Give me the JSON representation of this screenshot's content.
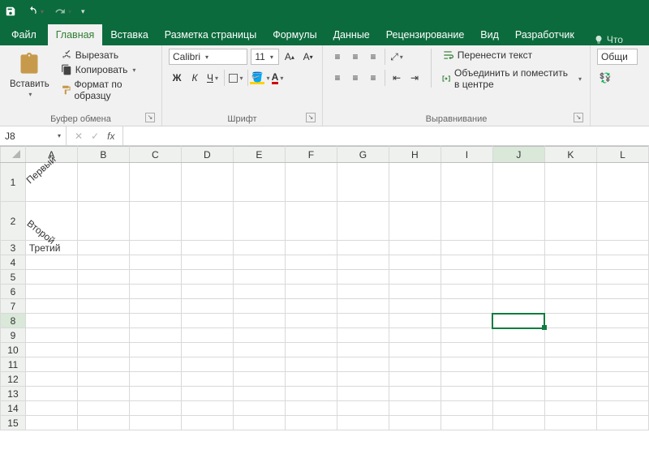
{
  "qat": {
    "save": "save",
    "undo": "undo",
    "redo": "redo"
  },
  "tabs": {
    "file": "Файл",
    "items": [
      "Главная",
      "Вставка",
      "Разметка страницы",
      "Формулы",
      "Данные",
      "Рецензирование",
      "Вид",
      "Разработчик"
    ],
    "active_index": 0,
    "tell_me": "Что"
  },
  "ribbon": {
    "clipboard": {
      "paste": "Вставить",
      "cut": "Вырезать",
      "copy": "Копировать",
      "format_painter": "Формат по образцу",
      "group_label": "Буфер обмена"
    },
    "font": {
      "name": "Calibri",
      "size": "11",
      "bold": "Ж",
      "italic": "К",
      "underline": "Ч",
      "group_label": "Шрифт"
    },
    "alignment": {
      "wrap": "Перенести текст",
      "merge": "Объединить и поместить в центре",
      "group_label": "Выравнивание"
    },
    "number": {
      "format": "Общи"
    }
  },
  "formula_bar": {
    "name_box": "J8",
    "formula": ""
  },
  "grid": {
    "columns": [
      "A",
      "B",
      "C",
      "D",
      "E",
      "F",
      "G",
      "H",
      "I",
      "J",
      "K",
      "L"
    ],
    "rows": [
      "1",
      "2",
      "3",
      "4",
      "5",
      "6",
      "7",
      "8",
      "9",
      "10",
      "11",
      "12",
      "13",
      "14",
      "15"
    ],
    "cells": {
      "A1": "Первый",
      "A2": "Второй",
      "A3": "Третий"
    },
    "active": "J8"
  }
}
